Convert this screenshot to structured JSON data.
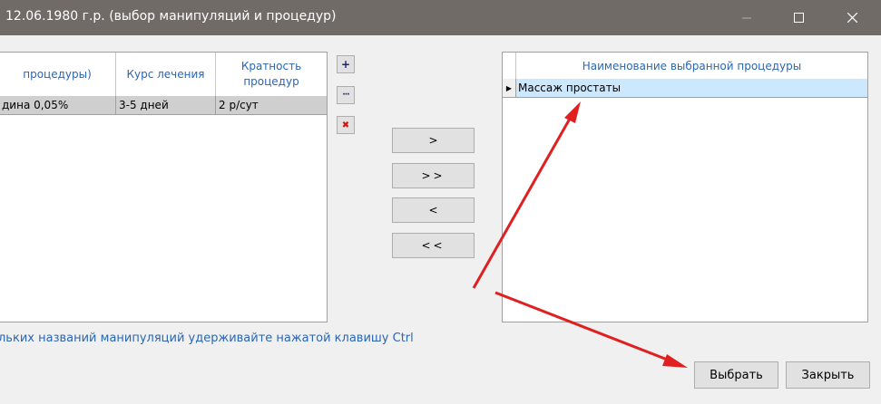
{
  "window": {
    "title": "12.06.1980 г.р. (выбор манипуляций и процедур)",
    "minimize_glyph": "—",
    "maximize_glyph": "☐",
    "close_glyph": "✕"
  },
  "left_grid": {
    "columns": [
      "процедуры)",
      "Курс лечения",
      "Кратность процедур"
    ],
    "rows": [
      [
        "дина 0,05%",
        "3-5 дней",
        "2 р/сут"
      ]
    ]
  },
  "side_buttons": {
    "add": "+",
    "edit": "···",
    "delete": "✖"
  },
  "move_buttons": {
    "move_one_right": ">",
    "move_all_right": ">>",
    "move_one_left": "<",
    "move_all_left": "<<"
  },
  "right_grid": {
    "column": "Наименование выбранной процедуры",
    "row_indicator": "▶",
    "rows": [
      "Массаж простаты"
    ]
  },
  "hint": "льких названий манипуляций удерживайте нажатой клавишу Ctrl",
  "dialog_buttons": {
    "select": "Выбрать",
    "close": "Закрыть"
  },
  "colors": {
    "titlebar": "#716b68",
    "header_text": "#2b66b2",
    "selected_row": "#cce8ff",
    "left_row": "#cfcfcf",
    "annotation_arrow": "#e02020",
    "delete_icon": "#d01010",
    "add_icon": "#1a237e"
  }
}
